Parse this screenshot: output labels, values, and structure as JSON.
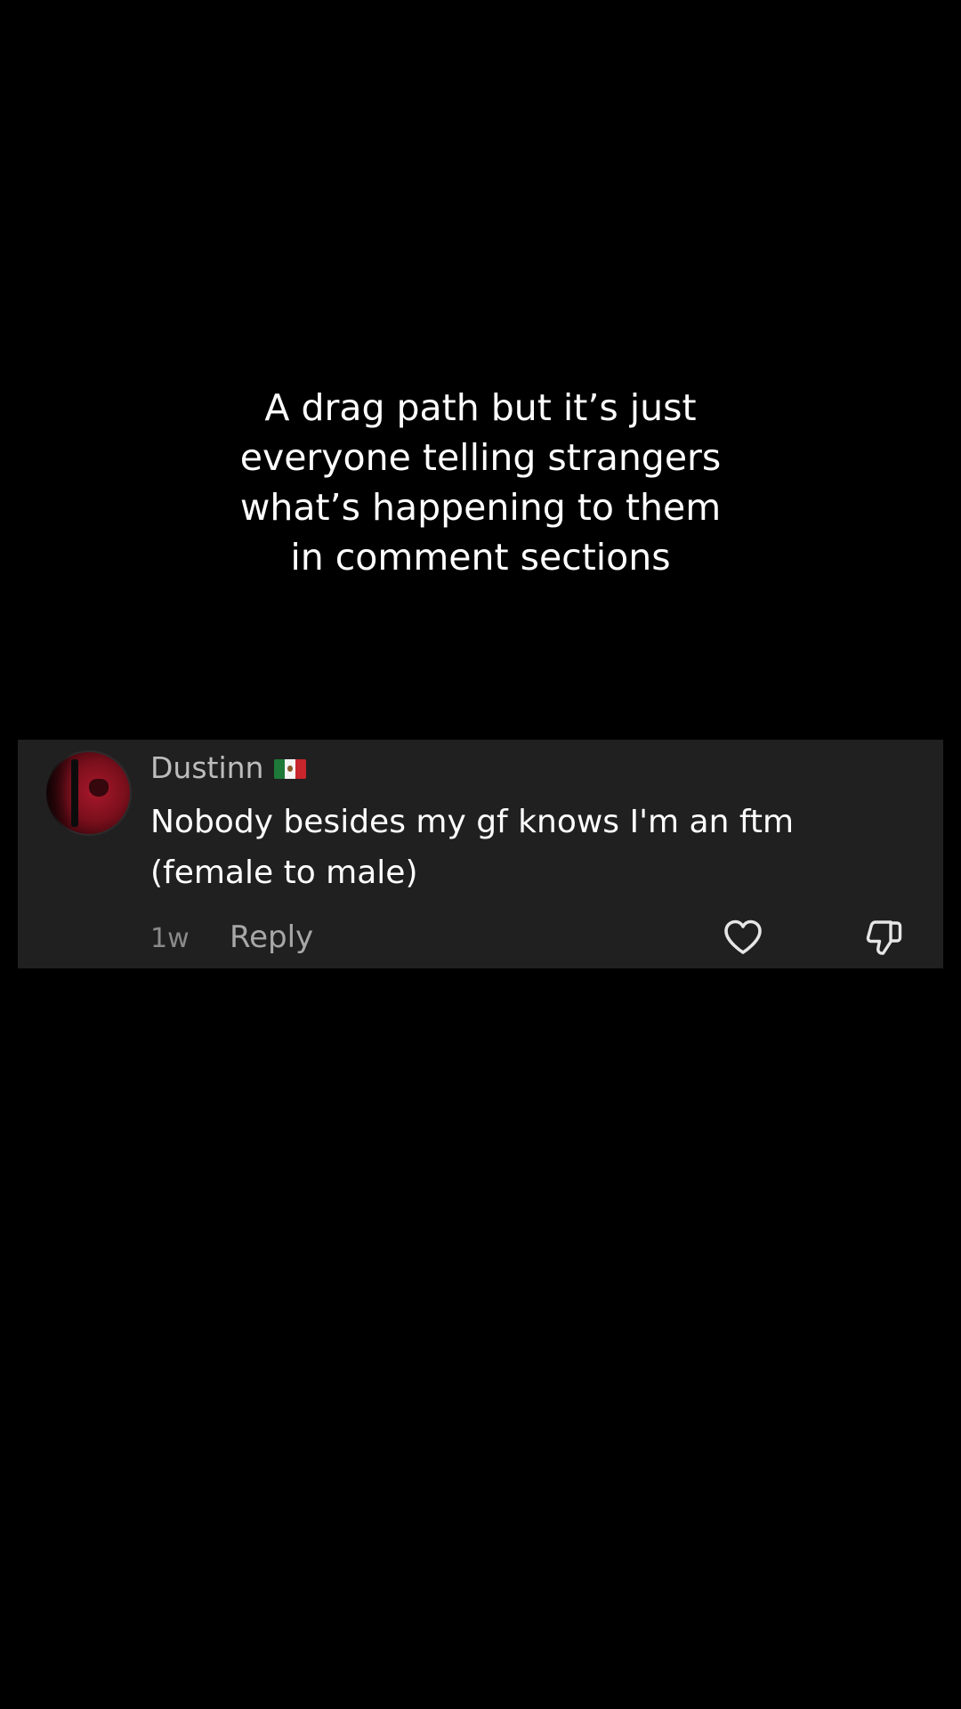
{
  "caption": {
    "lines": [
      "A drag path but it’s just",
      "everyone telling strangers",
      "what’s happening to them",
      "in comment sections"
    ]
  },
  "comment": {
    "username": "Dustinn",
    "flag_icon": "mexico-flag-icon",
    "text": "Nobody besides my gf knows I'm an ftm (female to male)",
    "time": "1w",
    "reply_label": "Reply",
    "like_icon": "heart-icon",
    "dislike_icon": "thumbs-down-icon"
  },
  "colors": {
    "background": "#000000",
    "card_background": "#202020",
    "username": "#bdbdbd",
    "comment_text": "#ffffff",
    "meta_text": "#8a8a8a"
  }
}
